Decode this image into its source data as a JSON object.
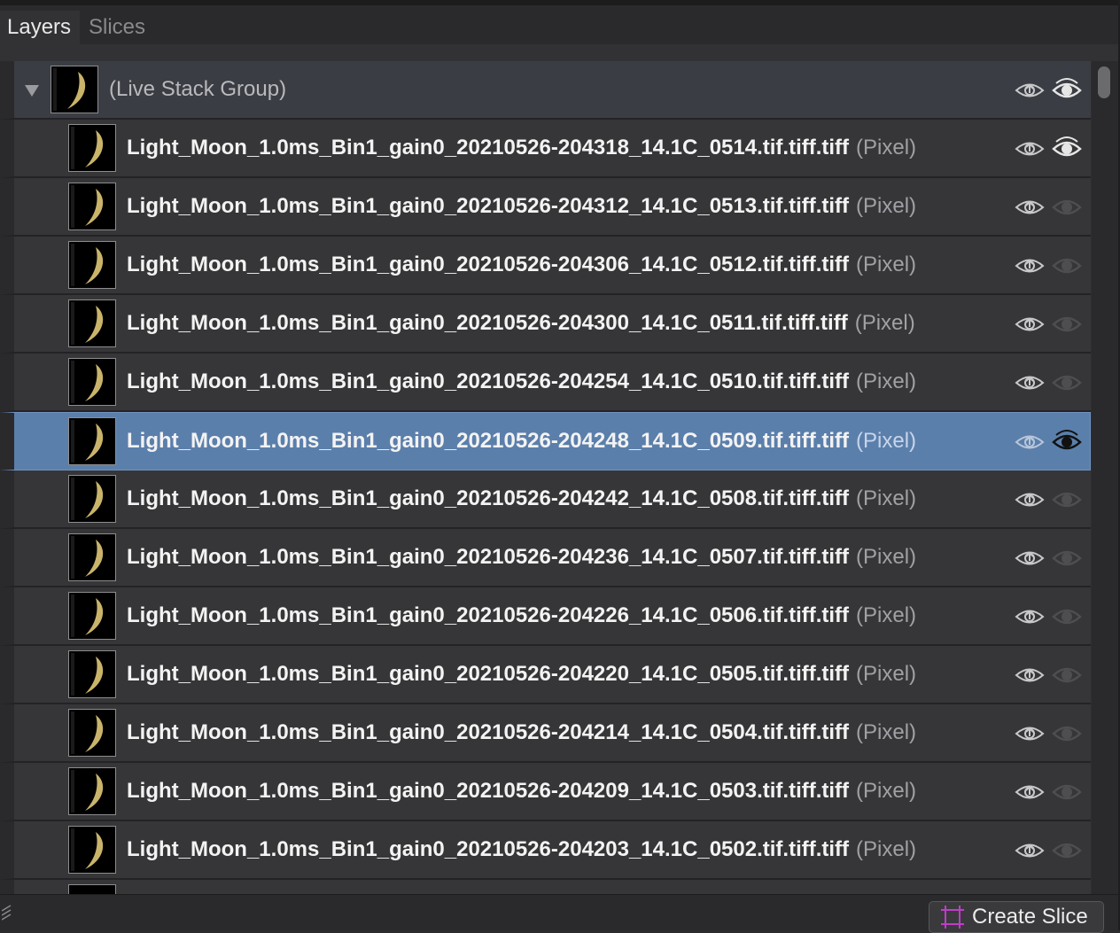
{
  "tabs": [
    {
      "label": "Layers",
      "active": true
    },
    {
      "label": "Slices",
      "active": false
    }
  ],
  "group": {
    "name": "(Live Stack Group)",
    "expanded": true,
    "edit_icon": "eye-arrow-icon",
    "visibility_icon": "eye-icon",
    "visible": true
  },
  "layers": [
    {
      "name": "Light_Moon_1.0ms_Bin1_gain0_20210526-204318_14.1C_0514.tif.tiff.tiff",
      "kind": "(Pixel)",
      "visible": true,
      "selected": false
    },
    {
      "name": "Light_Moon_1.0ms_Bin1_gain0_20210526-204312_14.1C_0513.tif.tiff.tiff",
      "kind": "(Pixel)",
      "visible": false,
      "selected": false
    },
    {
      "name": "Light_Moon_1.0ms_Bin1_gain0_20210526-204306_14.1C_0512.tif.tiff.tiff",
      "kind": "(Pixel)",
      "visible": false,
      "selected": false
    },
    {
      "name": "Light_Moon_1.0ms_Bin1_gain0_20210526-204300_14.1C_0511.tif.tiff.tiff",
      "kind": "(Pixel)",
      "visible": false,
      "selected": false
    },
    {
      "name": "Light_Moon_1.0ms_Bin1_gain0_20210526-204254_14.1C_0510.tif.tiff.tiff",
      "kind": "(Pixel)",
      "visible": false,
      "selected": false
    },
    {
      "name": "Light_Moon_1.0ms_Bin1_gain0_20210526-204248_14.1C_0509.tif.tiff.tiff",
      "kind": "(Pixel)",
      "visible": true,
      "selected": true
    },
    {
      "name": "Light_Moon_1.0ms_Bin1_gain0_20210526-204242_14.1C_0508.tif.tiff.tiff",
      "kind": "(Pixel)",
      "visible": false,
      "selected": false
    },
    {
      "name": "Light_Moon_1.0ms_Bin1_gain0_20210526-204236_14.1C_0507.tif.tiff.tiff",
      "kind": "(Pixel)",
      "visible": false,
      "selected": false
    },
    {
      "name": "Light_Moon_1.0ms_Bin1_gain0_20210526-204226_14.1C_0506.tif.tiff.tiff",
      "kind": "(Pixel)",
      "visible": false,
      "selected": false
    },
    {
      "name": "Light_Moon_1.0ms_Bin1_gain0_20210526-204220_14.1C_0505.tif.tiff.tiff",
      "kind": "(Pixel)",
      "visible": false,
      "selected": false
    },
    {
      "name": "Light_Moon_1.0ms_Bin1_gain0_20210526-204214_14.1C_0504.tif.tiff.tiff",
      "kind": "(Pixel)",
      "visible": false,
      "selected": false
    },
    {
      "name": "Light_Moon_1.0ms_Bin1_gain0_20210526-204209_14.1C_0503.tif.tiff.tiff",
      "kind": "(Pixel)",
      "visible": false,
      "selected": false
    },
    {
      "name": "Light_Moon_1.0ms_Bin1_gain0_20210526-204203_14.1C_0502.tif.tiff.tiff",
      "kind": "(Pixel)",
      "visible": false,
      "selected": false
    }
  ],
  "footer": {
    "create_slice_label": "Create Slice",
    "create_slice_icon": "slice-icon",
    "grip_icon": "resize-grip-icon"
  },
  "colors": {
    "selection": "#5b7fab",
    "slice_accent": "#c03cc9"
  }
}
